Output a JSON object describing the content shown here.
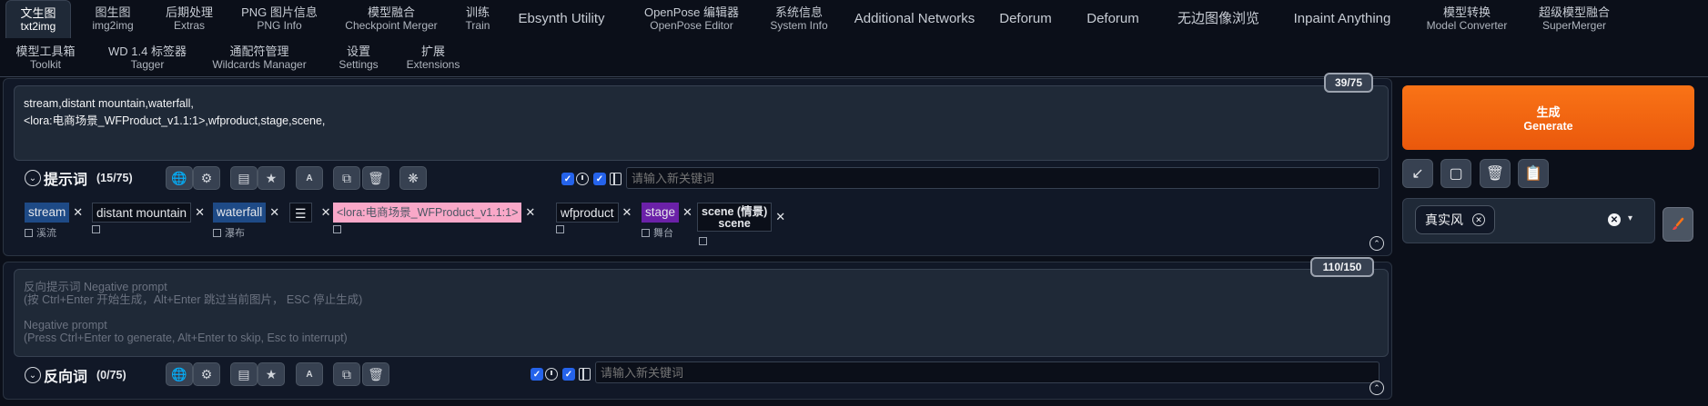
{
  "tabs_row1": [
    {
      "l1": "文生图",
      "l2": "txt2img",
      "active": true
    },
    {
      "l1": "图生图",
      "l2": "img2img"
    },
    {
      "l1": "后期处理",
      "l2": "Extras"
    },
    {
      "l1": "PNG 图片信息",
      "l2": "PNG Info"
    },
    {
      "l1": "模型融合",
      "l2": "Checkpoint Merger"
    },
    {
      "l1": "训练",
      "l2": "Train"
    },
    {
      "single": "Ebsynth Utility"
    },
    {
      "l1": "OpenPose 编辑器",
      "l2": "OpenPose Editor"
    },
    {
      "l1": "系统信息",
      "l2": "System Info"
    },
    {
      "single": "Additional Networks"
    },
    {
      "single": "Deforum"
    },
    {
      "single": "Deforum"
    },
    {
      "single": "无边图像浏览"
    },
    {
      "single": "Inpaint Anything"
    },
    {
      "l1": "模型转换",
      "l2": "Model Converter"
    },
    {
      "l1": "超级模型融合",
      "l2": "SuperMerger"
    }
  ],
  "tabs_row2": [
    {
      "l1": "模型工具箱",
      "l2": "Toolkit"
    },
    {
      "l1": "WD 1.4 标签器",
      "l2": "Tagger"
    },
    {
      "l1": "通配符管理",
      "l2": "Wildcards Manager"
    },
    {
      "l1": "设置",
      "l2": "Settings"
    },
    {
      "l1": "扩展",
      "l2": "Extensions"
    }
  ],
  "prompt": {
    "text_line1": "stream,distant mountain,waterfall,",
    "text_line2": "<lora:电商场景_WFProduct_v1.1:1>,wfproduct,stage,scene,",
    "counter": "39/75",
    "title": "提示词",
    "count": "(15/75)",
    "keyword_placeholder": "请输入新关键词",
    "tags": [
      {
        "text": "stream",
        "trans": "溪流"
      },
      {
        "text": "distant mountain",
        "trans": ""
      },
      {
        "text": "waterfall",
        "trans": "瀑布"
      },
      {
        "text": "<lora:电商场景_WFProduct_v1.1:1>",
        "trans": ""
      },
      {
        "text": "wfproduct",
        "trans": ""
      },
      {
        "text": "stage",
        "trans": "舞台"
      },
      {
        "text_l1": "scene (情景)",
        "text_l2": "scene",
        "trans": ""
      }
    ]
  },
  "negative": {
    "placeholder_line1": "反向提示词 Negative prompt",
    "placeholder_line2": "(按 Ctrl+Enter 开始生成，Alt+Enter 跳过当前图片， ESC 停止生成)",
    "placeholder_line3": "Negative prompt",
    "placeholder_line4": "(Press Ctrl+Enter to generate, Alt+Enter to skip, Esc to interrupt)",
    "counter": "110/150",
    "title": "反向词",
    "count": "(0/75)",
    "keyword_placeholder": "请输入新关键词"
  },
  "generate": {
    "label_cn": "生成",
    "label_en": "Generate"
  },
  "styles": {
    "selected": "真实风"
  },
  "colors": {
    "accent": "#f97316",
    "tag_blue": "#1e4a86",
    "tag_pink": "#f9a8c8",
    "tag_purple": "#6b21a8",
    "background": "#0b0f19"
  }
}
